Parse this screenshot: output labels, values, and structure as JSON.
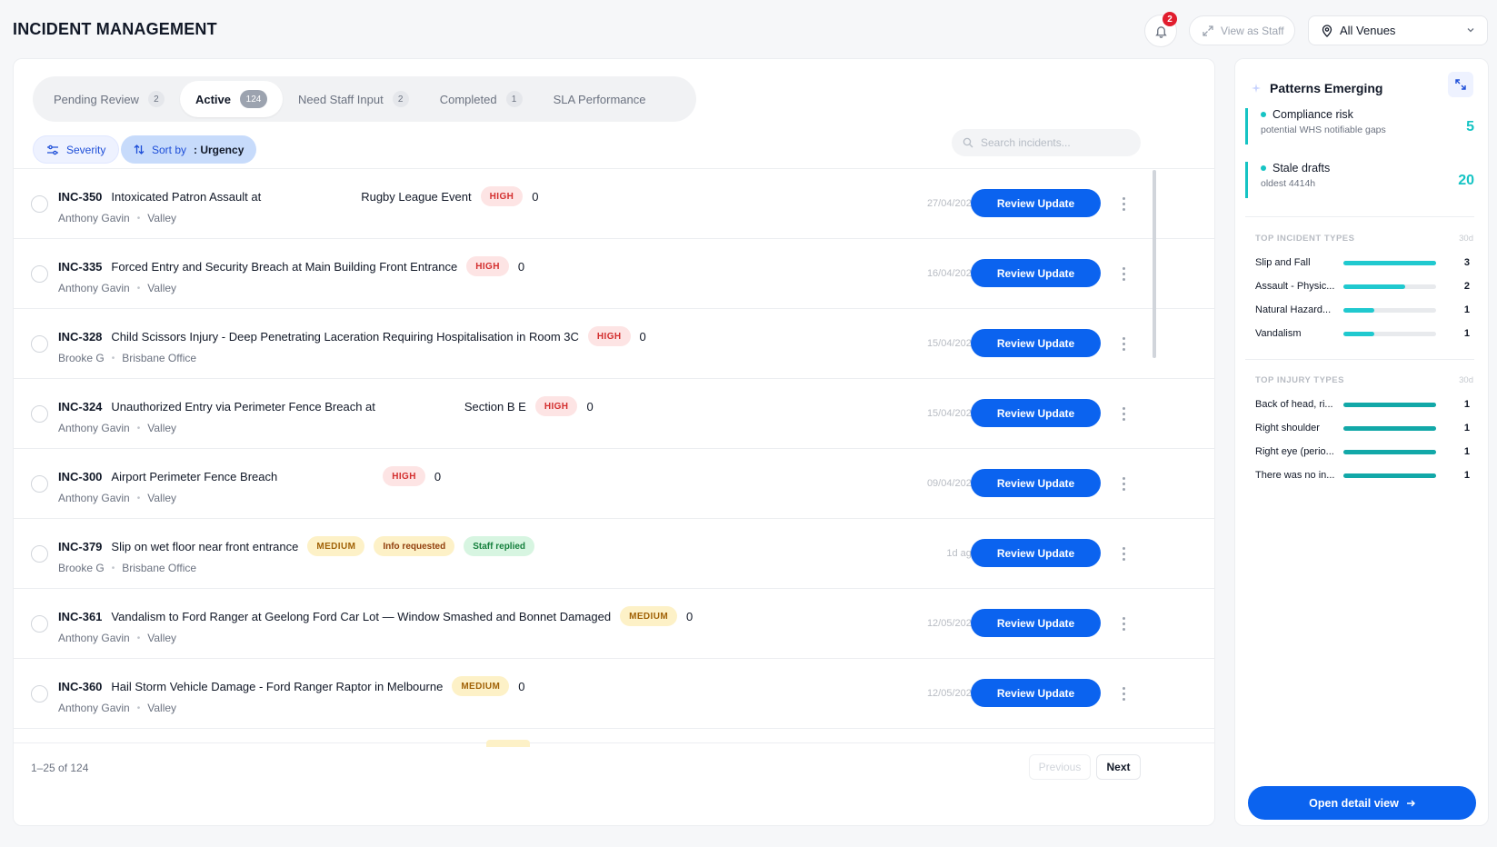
{
  "app": {
    "title": "INCIDENT MANAGEMENT"
  },
  "header": {
    "notification_count": "2",
    "view_as_staff_label": "View as Staff",
    "venue_selected": "All Venues"
  },
  "tabs": [
    {
      "label": "Pending Review",
      "count": "2",
      "active": false
    },
    {
      "label": "Active",
      "count": "124",
      "active": true
    },
    {
      "label": "Need Staff Input",
      "count": "2",
      "active": false
    },
    {
      "label": "Completed",
      "count": "1",
      "active": false
    },
    {
      "label": "SLA Performance",
      "count": "",
      "active": false
    }
  ],
  "filters": {
    "severity_label": "Severity",
    "sort_prefix": "Sort by",
    "sort_value": ": Urgency",
    "search_placeholder": "Search incidents..."
  },
  "incidents": [
    {
      "id": "INC-350",
      "title": "Intoxicated Patron Assault at",
      "title_tail": "Rugby League Event",
      "severity": "HIGH",
      "count": "0",
      "tags": [],
      "reporter": "Anthony Gavin",
      "venue": "Valley",
      "date": "27/04/2026"
    },
    {
      "id": "INC-335",
      "title": "Forced Entry and Security Breach at Main Building Front Entrance",
      "title_tail": "",
      "severity": "HIGH",
      "count": "0",
      "tags": [],
      "reporter": "Anthony Gavin",
      "venue": "Valley",
      "date": "16/04/2026"
    },
    {
      "id": "INC-328",
      "title": "Child Scissors Injury - Deep Penetrating Laceration Requiring Hospitalisation in Room 3C",
      "title_tail": "",
      "severity": "HIGH",
      "count": "0",
      "tags": [],
      "reporter": "Brooke G",
      "venue": "Brisbane Office",
      "date": "15/04/2026"
    },
    {
      "id": "INC-324",
      "title": "Unauthorized Entry via Perimeter Fence Breach at",
      "title_tail": "Section B E",
      "severity": "HIGH",
      "count": "0",
      "tags": [],
      "reporter": "Anthony Gavin",
      "venue": "Valley",
      "date": "15/04/2026"
    },
    {
      "id": "INC-300",
      "title": "Airport Perimeter Fence Breach",
      "title_tail": "",
      "severity": "HIGH",
      "count": "0",
      "tags": [],
      "reporter": "Anthony Gavin",
      "venue": "Valley",
      "date": "09/04/2026"
    },
    {
      "id": "INC-379",
      "title": "Slip on wet floor near front entrance",
      "title_tail": "",
      "severity": "MEDIUM",
      "count": "",
      "tags": [
        "Info requested",
        "Staff replied"
      ],
      "reporter": "Brooke G",
      "venue": "Brisbane Office",
      "date": "1d ago"
    },
    {
      "id": "INC-361",
      "title": "Vandalism to Ford Ranger at Geelong Ford Car Lot — Window Smashed and Bonnet Damaged",
      "title_tail": "",
      "severity": "MEDIUM",
      "count": "0",
      "tags": [],
      "reporter": "Anthony Gavin",
      "venue": "Valley",
      "date": "12/05/2026"
    },
    {
      "id": "INC-360",
      "title": "Hail Storm Vehicle Damage - Ford Ranger Raptor in Melbourne",
      "title_tail": "",
      "severity": "MEDIUM",
      "count": "0",
      "tags": [],
      "reporter": "Anthony Gavin",
      "venue": "Valley",
      "date": "12/05/2026"
    }
  ],
  "row_action_label": "Review Update",
  "pagination": {
    "summary": "1–25 of 124",
    "previous_label": "Previous",
    "next_label": "Next"
  },
  "panel": {
    "title": "Patterns Emerging",
    "insights": [
      {
        "title": "Compliance risk",
        "subtitle": "potential WHS notifiable gaps",
        "value": "5"
      },
      {
        "title": "Stale drafts",
        "subtitle": "oldest 4414h",
        "value": "20"
      }
    ],
    "incident_types": {
      "heading": "TOP INCIDENT TYPES",
      "period": "30d",
      "color": "#20c9cf",
      "items": [
        {
          "label": "Slip and Fall",
          "value": 3
        },
        {
          "label": "Assault - Physic...",
          "value": 2
        },
        {
          "label": "Natural Hazard...",
          "value": 1
        },
        {
          "label": "Vandalism",
          "value": 1
        }
      ]
    },
    "injury_types": {
      "heading": "TOP INJURY TYPES",
      "period": "30d",
      "color": "#12a8a8",
      "items": [
        {
          "label": "Back of head, ri...",
          "value": 1
        },
        {
          "label": "Right shoulder",
          "value": 1
        },
        {
          "label": "Right eye (perio...",
          "value": 1
        },
        {
          "label": "There was no in...",
          "value": 1
        }
      ]
    },
    "open_detail_label": "Open detail view"
  },
  "colors": {
    "primary": "#0b63ef",
    "accent": "#16c4c4",
    "high_bg": "#fde4e4",
    "high_text": "#d32f2f",
    "medium_bg": "#fdf1c7",
    "medium_text": "#a16207"
  }
}
